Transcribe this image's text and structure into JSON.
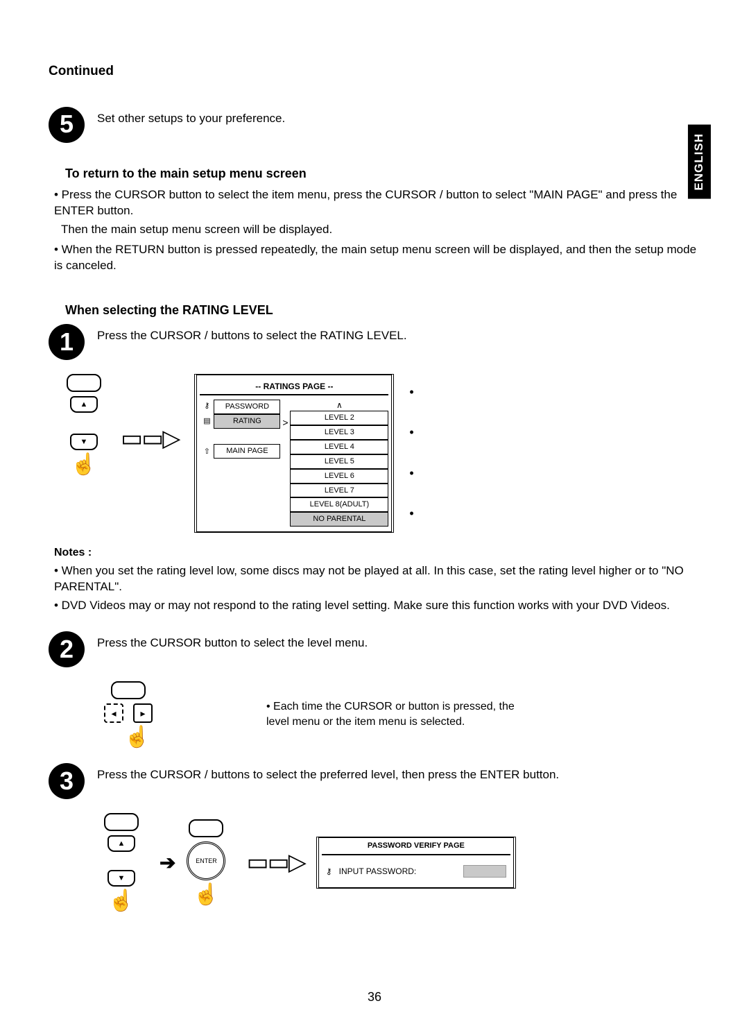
{
  "language_tab": "ENGLISH",
  "continued": "Continued",
  "step5": {
    "num": "5",
    "text": "Set other setups to your preference."
  },
  "return_heading": "To return to the main setup menu screen",
  "return_b1": "• Press the CURSOR      button to select the item menu, press the CURSOR      /      button to select \"MAIN PAGE\" and press the ENTER button.",
  "return_b1b": "Then the main setup menu screen will be displayed.",
  "return_b2": "• When the RETURN button is pressed repeatedly, the main setup menu screen will be displayed, and then the setup mode is canceled.",
  "rating_heading": "When selecting the RATING LEVEL",
  "step1": {
    "num": "1",
    "text": "Press the CURSOR      /      buttons to select the RATING LEVEL."
  },
  "ratings_screen": {
    "title": "-- RATINGS PAGE --",
    "items": [
      "PASSWORD",
      "RATING",
      "",
      "MAIN PAGE"
    ],
    "levels": [
      "LEVEL 2",
      "LEVEL 3",
      "LEVEL 4",
      "LEVEL 5",
      "LEVEL 6",
      "LEVEL 7",
      "LEVEL 8(ADULT)",
      "NO PARENTAL"
    ],
    "selected_level": "NO PARENTAL"
  },
  "notes_label": "Notes :",
  "note1": "• When you set the rating level low, some discs may not be played at all. In this case, set the rating level higher or to \"NO PARENTAL\".",
  "note2": "• DVD Videos may or may not respond to the rating level setting. Make sure this function works with your DVD Videos.",
  "step2": {
    "num": "2",
    "text": "Press the CURSOR      button to select the level menu."
  },
  "step2_side": "• Each time the CURSOR      or      button is pressed, the level menu or the item menu is selected.",
  "step3": {
    "num": "3",
    "text": "Press the CURSOR      /      buttons to select the preferred level, then press the ENTER button."
  },
  "enter_label": "ENTER",
  "pw_screen": {
    "title": "PASSWORD VERIFY PAGE",
    "label": "INPUT PASSWORD:"
  },
  "page_number": "36"
}
